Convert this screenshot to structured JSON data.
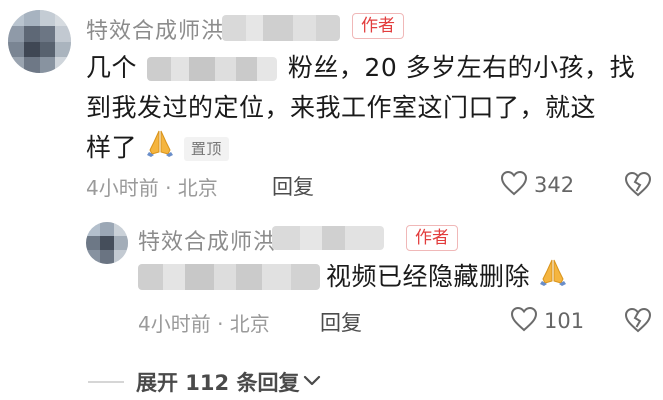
{
  "comment": {
    "author": "特效合成师洪",
    "author_tag": "作者",
    "line1_a": "几个",
    "line1_b": "粉丝，20 多岁左右的小孩，找",
    "line2": "到我发过的定位，来我工作室这门口了，就这",
    "line3": "样了",
    "emoji": "pray-hands",
    "pinned_label": "置顶",
    "time": "4小时前 · 北京",
    "reply_label": "回复",
    "like_count": "342"
  },
  "reply": {
    "author": "特效合成师洪",
    "author_tag": "作者",
    "text": "视频已经隐藏删除",
    "emoji": "pray-hands",
    "time": "4小时前 · 北京",
    "reply_label": "回复",
    "like_count": "101"
  },
  "expand": {
    "label": "展开 112 条回复"
  },
  "colors": {
    "tag_red": "#e23d3d",
    "muted": "#9a9a9a"
  }
}
